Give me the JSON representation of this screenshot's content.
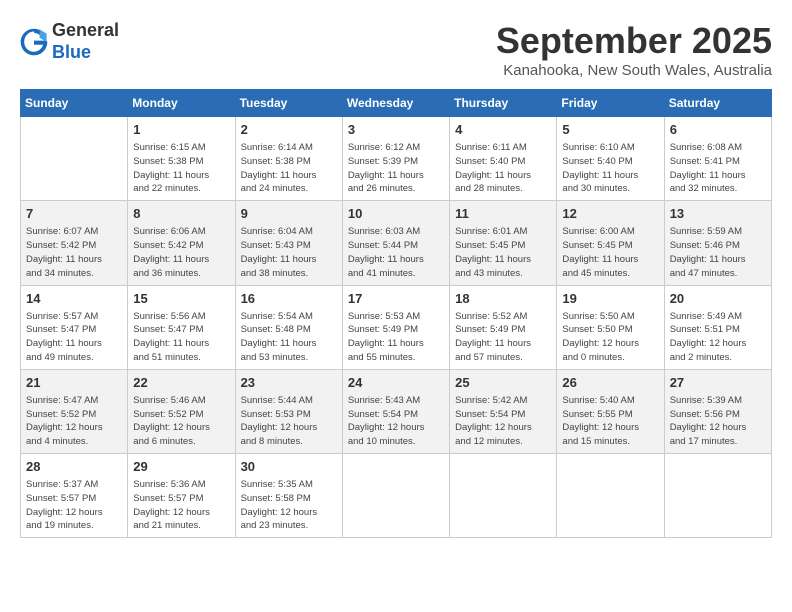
{
  "header": {
    "logo_general": "General",
    "logo_blue": "Blue",
    "title": "September 2025",
    "subtitle": "Kanahooka, New South Wales, Australia"
  },
  "days_of_week": [
    "Sunday",
    "Monday",
    "Tuesday",
    "Wednesday",
    "Thursday",
    "Friday",
    "Saturday"
  ],
  "weeks": [
    [
      {
        "day": "",
        "info": ""
      },
      {
        "day": "1",
        "info": "Sunrise: 6:15 AM\nSunset: 5:38 PM\nDaylight: 11 hours\nand 22 minutes."
      },
      {
        "day": "2",
        "info": "Sunrise: 6:14 AM\nSunset: 5:38 PM\nDaylight: 11 hours\nand 24 minutes."
      },
      {
        "day": "3",
        "info": "Sunrise: 6:12 AM\nSunset: 5:39 PM\nDaylight: 11 hours\nand 26 minutes."
      },
      {
        "day": "4",
        "info": "Sunrise: 6:11 AM\nSunset: 5:40 PM\nDaylight: 11 hours\nand 28 minutes."
      },
      {
        "day": "5",
        "info": "Sunrise: 6:10 AM\nSunset: 5:40 PM\nDaylight: 11 hours\nand 30 minutes."
      },
      {
        "day": "6",
        "info": "Sunrise: 6:08 AM\nSunset: 5:41 PM\nDaylight: 11 hours\nand 32 minutes."
      }
    ],
    [
      {
        "day": "7",
        "info": "Sunrise: 6:07 AM\nSunset: 5:42 PM\nDaylight: 11 hours\nand 34 minutes."
      },
      {
        "day": "8",
        "info": "Sunrise: 6:06 AM\nSunset: 5:42 PM\nDaylight: 11 hours\nand 36 minutes."
      },
      {
        "day": "9",
        "info": "Sunrise: 6:04 AM\nSunset: 5:43 PM\nDaylight: 11 hours\nand 38 minutes."
      },
      {
        "day": "10",
        "info": "Sunrise: 6:03 AM\nSunset: 5:44 PM\nDaylight: 11 hours\nand 41 minutes."
      },
      {
        "day": "11",
        "info": "Sunrise: 6:01 AM\nSunset: 5:45 PM\nDaylight: 11 hours\nand 43 minutes."
      },
      {
        "day": "12",
        "info": "Sunrise: 6:00 AM\nSunset: 5:45 PM\nDaylight: 11 hours\nand 45 minutes."
      },
      {
        "day": "13",
        "info": "Sunrise: 5:59 AM\nSunset: 5:46 PM\nDaylight: 11 hours\nand 47 minutes."
      }
    ],
    [
      {
        "day": "14",
        "info": "Sunrise: 5:57 AM\nSunset: 5:47 PM\nDaylight: 11 hours\nand 49 minutes."
      },
      {
        "day": "15",
        "info": "Sunrise: 5:56 AM\nSunset: 5:47 PM\nDaylight: 11 hours\nand 51 minutes."
      },
      {
        "day": "16",
        "info": "Sunrise: 5:54 AM\nSunset: 5:48 PM\nDaylight: 11 hours\nand 53 minutes."
      },
      {
        "day": "17",
        "info": "Sunrise: 5:53 AM\nSunset: 5:49 PM\nDaylight: 11 hours\nand 55 minutes."
      },
      {
        "day": "18",
        "info": "Sunrise: 5:52 AM\nSunset: 5:49 PM\nDaylight: 11 hours\nand 57 minutes."
      },
      {
        "day": "19",
        "info": "Sunrise: 5:50 AM\nSunset: 5:50 PM\nDaylight: 12 hours\nand 0 minutes."
      },
      {
        "day": "20",
        "info": "Sunrise: 5:49 AM\nSunset: 5:51 PM\nDaylight: 12 hours\nand 2 minutes."
      }
    ],
    [
      {
        "day": "21",
        "info": "Sunrise: 5:47 AM\nSunset: 5:52 PM\nDaylight: 12 hours\nand 4 minutes."
      },
      {
        "day": "22",
        "info": "Sunrise: 5:46 AM\nSunset: 5:52 PM\nDaylight: 12 hours\nand 6 minutes."
      },
      {
        "day": "23",
        "info": "Sunrise: 5:44 AM\nSunset: 5:53 PM\nDaylight: 12 hours\nand 8 minutes."
      },
      {
        "day": "24",
        "info": "Sunrise: 5:43 AM\nSunset: 5:54 PM\nDaylight: 12 hours\nand 10 minutes."
      },
      {
        "day": "25",
        "info": "Sunrise: 5:42 AM\nSunset: 5:54 PM\nDaylight: 12 hours\nand 12 minutes."
      },
      {
        "day": "26",
        "info": "Sunrise: 5:40 AM\nSunset: 5:55 PM\nDaylight: 12 hours\nand 15 minutes."
      },
      {
        "day": "27",
        "info": "Sunrise: 5:39 AM\nSunset: 5:56 PM\nDaylight: 12 hours\nand 17 minutes."
      }
    ],
    [
      {
        "day": "28",
        "info": "Sunrise: 5:37 AM\nSunset: 5:57 PM\nDaylight: 12 hours\nand 19 minutes."
      },
      {
        "day": "29",
        "info": "Sunrise: 5:36 AM\nSunset: 5:57 PM\nDaylight: 12 hours\nand 21 minutes."
      },
      {
        "day": "30",
        "info": "Sunrise: 5:35 AM\nSunset: 5:58 PM\nDaylight: 12 hours\nand 23 minutes."
      },
      {
        "day": "",
        "info": ""
      },
      {
        "day": "",
        "info": ""
      },
      {
        "day": "",
        "info": ""
      },
      {
        "day": "",
        "info": ""
      }
    ]
  ]
}
